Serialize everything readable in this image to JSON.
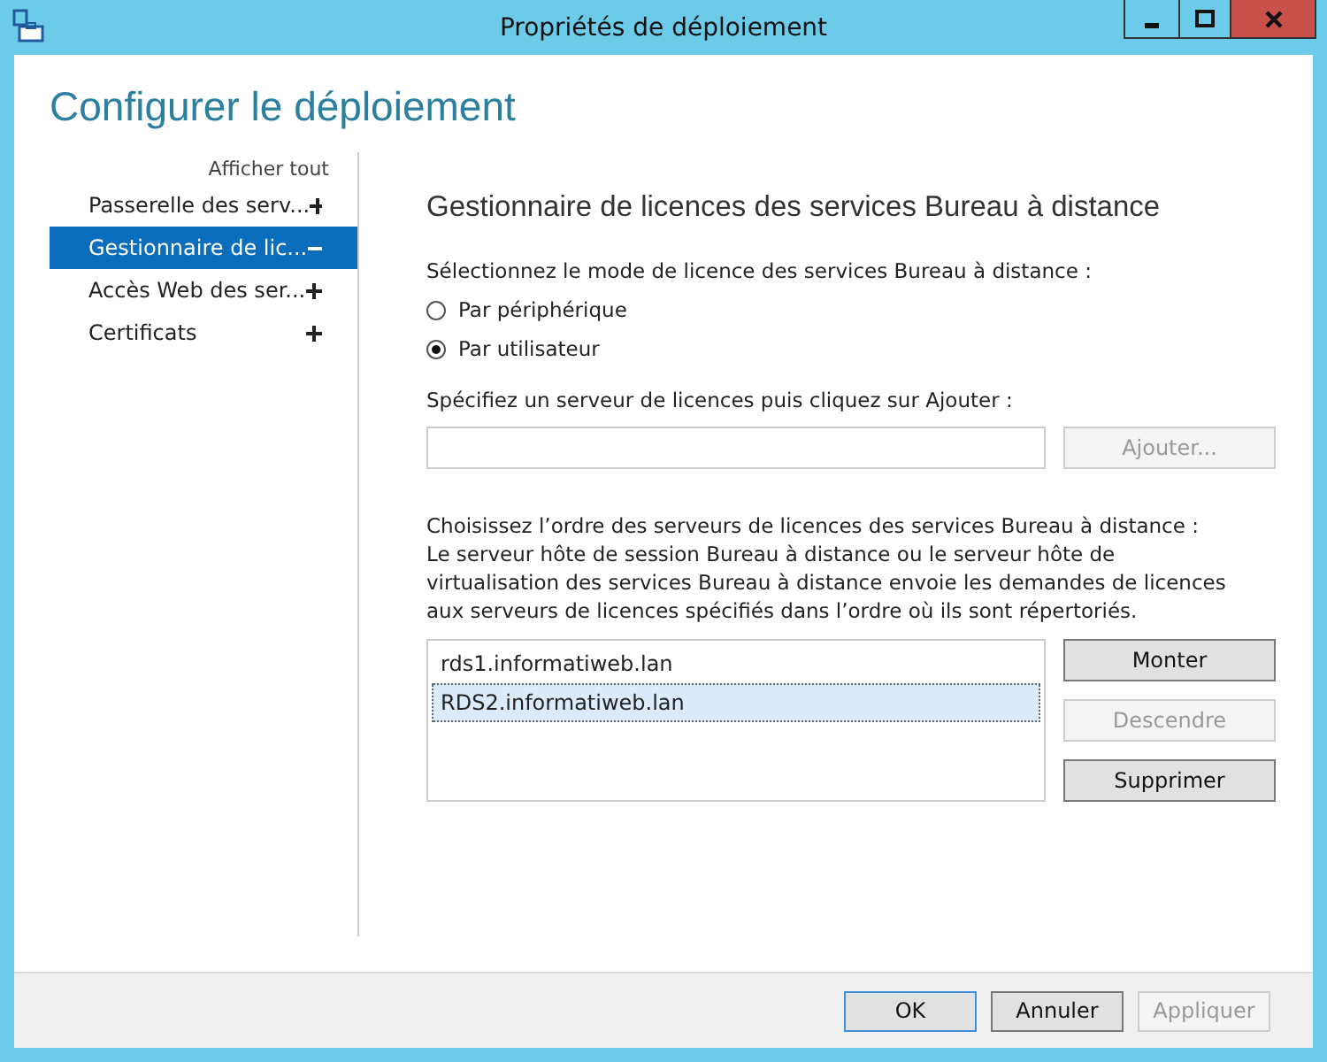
{
  "window": {
    "title": "Propriétés de déploiement"
  },
  "heading": "Configurer le déploiement",
  "sidebar": {
    "show_all": "Afficher tout",
    "items": [
      {
        "label": "Passerelle des serv...",
        "expanded": false,
        "selected": false
      },
      {
        "label": "Gestionnaire de lic...",
        "expanded": true,
        "selected": true
      },
      {
        "label": "Accès Web des ser...",
        "expanded": false,
        "selected": false
      },
      {
        "label": "Certificats",
        "expanded": false,
        "selected": false
      }
    ]
  },
  "content": {
    "title": "Gestionnaire de licences des services Bureau à distance",
    "mode_label": "Sélectionnez le mode de licence des services Bureau à distance :",
    "modes": [
      {
        "label": "Par périphérique",
        "selected": false
      },
      {
        "label": "Par utilisateur",
        "selected": true
      }
    ],
    "server_label": "Spécifiez un serveur de licences puis cliquez sur Ajouter :",
    "add_button": {
      "label": "Ajouter...",
      "disabled": true
    },
    "order_label": "Choisissez l’ordre des serveurs de licences des services Bureau à distance :",
    "order_description": "Le serveur hôte de session Bureau à distance ou le serveur hôte de virtualisation des services Bureau à distance envoie les demandes de licences aux serveurs de licences spécifiés dans l’ordre où ils sont répertoriés.",
    "servers": [
      {
        "name": "rds1.informatiweb.lan",
        "selected": false
      },
      {
        "name": "RDS2.informatiweb.lan",
        "selected": true
      }
    ],
    "list_buttons": [
      {
        "label": "Monter",
        "disabled": false
      },
      {
        "label": "Descendre",
        "disabled": true
      },
      {
        "label": "Supprimer",
        "disabled": false
      }
    ]
  },
  "footer_buttons": [
    {
      "label": "OK",
      "disabled": false,
      "default": true
    },
    {
      "label": "Annuler",
      "disabled": false,
      "default": false
    },
    {
      "label": "Appliquer",
      "disabled": true,
      "default": false
    }
  ]
}
